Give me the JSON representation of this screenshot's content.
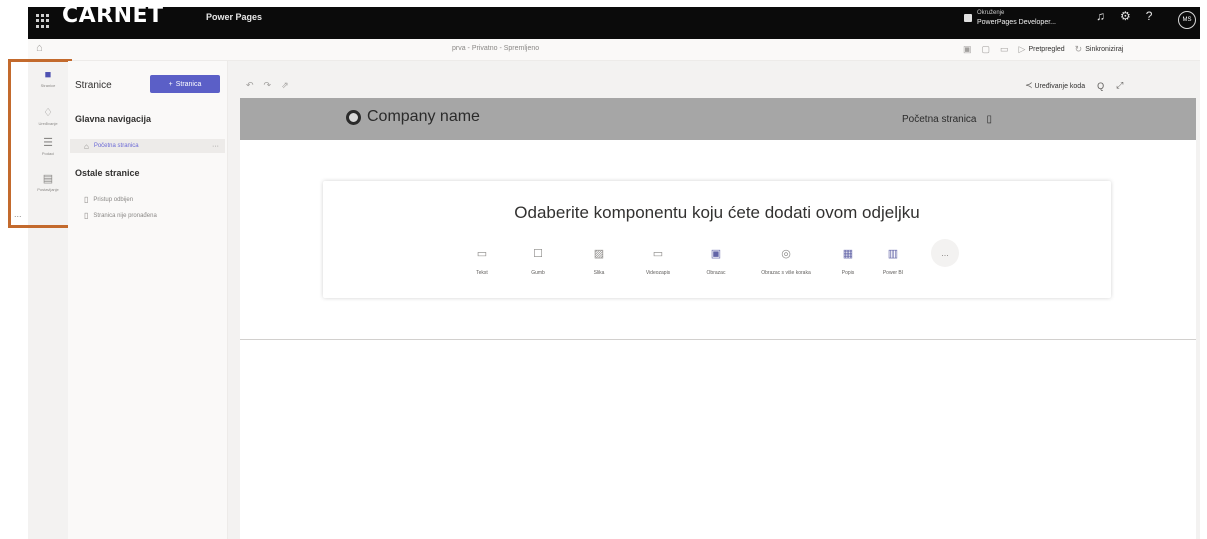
{
  "topbar": {
    "logo": "CARNET",
    "product": "Power Pages",
    "env_label": "Okruženje",
    "env_name": "PowerPages Developer...",
    "icons": [
      "bell-icon",
      "gear-icon",
      "help-icon"
    ],
    "avatar": "MS"
  },
  "subbar": {
    "site_title": "prva - Privatno - Spremljeno",
    "preview_label": "Pretpregled",
    "sync_label": "Sinkroniziraj"
  },
  "rail": {
    "items": [
      {
        "label": "Stranice",
        "icon": "page-icon"
      },
      {
        "label": "Uređivanje",
        "icon": "brush-icon"
      },
      {
        "label": "Podaci",
        "icon": "database-icon"
      },
      {
        "label": "Postavljanje",
        "icon": "setup-icon"
      }
    ],
    "more": "..."
  },
  "pages": {
    "title": "Stranice",
    "add_button": "Stranica",
    "main_nav_title": "Glavna navigacija",
    "main_nav_items": [
      {
        "label": "Početna stranica"
      }
    ],
    "other_title": "Ostale stranice",
    "other_items": [
      {
        "label": "Pristup odbijen"
      },
      {
        "label": "Stranica nije pronađena"
      }
    ]
  },
  "toolbar": {
    "edit_code": "Uređivanje koda",
    "zoom": "Q"
  },
  "site": {
    "company": "Company name",
    "home_link": "Početna stranica"
  },
  "card": {
    "heading": "Odaberite komponentu koju ćete dodati ovom odjeljku",
    "components": [
      {
        "label": "Tekst",
        "icon": "text-icon"
      },
      {
        "label": "Gumb",
        "icon": "button-icon"
      },
      {
        "label": "Slika",
        "icon": "image-icon"
      },
      {
        "label": "Videozapis",
        "icon": "video-icon"
      },
      {
        "label": "Obrazac",
        "icon": "form-icon"
      },
      {
        "label": "Obrazac s više koraka",
        "icon": "multistep-form-icon"
      },
      {
        "label": "Popis",
        "icon": "list-icon"
      },
      {
        "label": "Power BI",
        "icon": "power-bi-icon"
      }
    ],
    "more": "..."
  }
}
